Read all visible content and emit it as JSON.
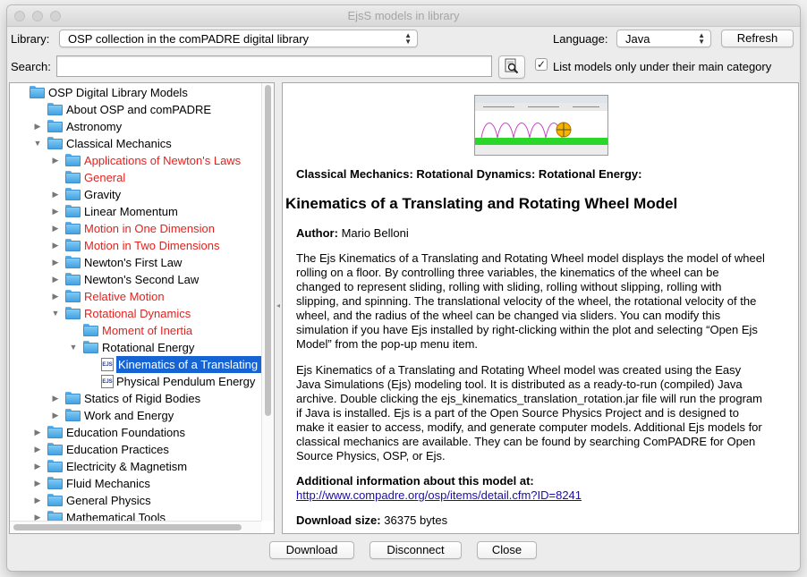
{
  "window": {
    "title": "EjsS models in library"
  },
  "toolbar": {
    "library_label": "Library:",
    "library_value": "OSP collection in the comPADRE digital library",
    "language_label": "Language:",
    "language_value": "Java",
    "refresh_label": "Refresh",
    "search_label": "Search:",
    "search_value": "",
    "checkbox_checked": true,
    "checkbox_label": "List models only under their main category"
  },
  "tree": {
    "items": [
      {
        "label": "OSP Digital Library Models",
        "level": 0,
        "expander": "none",
        "icon": "folder",
        "color": "normal"
      },
      {
        "label": "About OSP and comPADRE",
        "level": 1,
        "expander": "none",
        "icon": "folder",
        "color": "normal"
      },
      {
        "label": "Astronomy",
        "level": 1,
        "expander": "collapsed",
        "icon": "folder",
        "color": "normal"
      },
      {
        "label": "Classical Mechanics",
        "level": 1,
        "expander": "expanded",
        "icon": "folder",
        "color": "normal"
      },
      {
        "label": "Applications of Newton's Laws",
        "level": 2,
        "expander": "collapsed",
        "icon": "folder",
        "color": "red"
      },
      {
        "label": "General",
        "level": 2,
        "expander": "none",
        "icon": "folder",
        "color": "red"
      },
      {
        "label": "Gravity",
        "level": 2,
        "expander": "collapsed",
        "icon": "folder",
        "color": "normal"
      },
      {
        "label": "Linear Momentum",
        "level": 2,
        "expander": "collapsed",
        "icon": "folder",
        "color": "normal"
      },
      {
        "label": "Motion in One Dimension",
        "level": 2,
        "expander": "collapsed",
        "icon": "folder",
        "color": "red"
      },
      {
        "label": "Motion in Two Dimensions",
        "level": 2,
        "expander": "collapsed",
        "icon": "folder",
        "color": "red"
      },
      {
        "label": "Newton's First Law",
        "level": 2,
        "expander": "collapsed",
        "icon": "folder",
        "color": "normal"
      },
      {
        "label": "Newton's Second Law",
        "level": 2,
        "expander": "collapsed",
        "icon": "folder",
        "color": "normal"
      },
      {
        "label": "Relative Motion",
        "level": 2,
        "expander": "collapsed",
        "icon": "folder",
        "color": "red"
      },
      {
        "label": "Rotational Dynamics",
        "level": 2,
        "expander": "expanded",
        "icon": "folder",
        "color": "red"
      },
      {
        "label": "Moment of Inertia",
        "level": 3,
        "expander": "none",
        "icon": "folder",
        "color": "red"
      },
      {
        "label": "Rotational Energy",
        "level": 3,
        "expander": "expanded",
        "icon": "folder",
        "color": "normal"
      },
      {
        "label": "Kinematics of a Translating and",
        "level": 4,
        "expander": "none",
        "icon": "ejs-doc",
        "color": "selected"
      },
      {
        "label": "Physical Pendulum Energy",
        "level": 4,
        "expander": "none",
        "icon": "ejs-doc",
        "color": "normal"
      },
      {
        "label": "Statics of Rigid Bodies",
        "level": 2,
        "expander": "collapsed",
        "icon": "folder",
        "color": "normal"
      },
      {
        "label": "Work and Energy",
        "level": 2,
        "expander": "collapsed",
        "icon": "folder",
        "color": "normal"
      },
      {
        "label": "Education Foundations",
        "level": 1,
        "expander": "collapsed",
        "icon": "folder",
        "color": "normal"
      },
      {
        "label": "Education Practices",
        "level": 1,
        "expander": "collapsed",
        "icon": "folder",
        "color": "normal"
      },
      {
        "label": "Electricity & Magnetism",
        "level": 1,
        "expander": "collapsed",
        "icon": "folder",
        "color": "normal"
      },
      {
        "label": "Fluid Mechanics",
        "level": 1,
        "expander": "collapsed",
        "icon": "folder",
        "color": "normal"
      },
      {
        "label": "General Physics",
        "level": 1,
        "expander": "collapsed",
        "icon": "folder",
        "color": "normal"
      },
      {
        "label": "Mathematical Tools",
        "level": 1,
        "expander": "collapsed",
        "icon": "folder",
        "color": "normal"
      }
    ]
  },
  "detail": {
    "category": "Classical Mechanics: Rotational Dynamics: Rotational Energy:",
    "title": "Kinematics of a Translating and Rotating Wheel Model",
    "author_label": "Author:",
    "author_value": "Mario Belloni",
    "paragraph1": "The Ejs Kinematics of a Translating and Rotating Wheel model displays the model of wheel rolling on a floor. By controlling three variables, the kinematics of the wheel can be changed to represent sliding, rolling with sliding, rolling without slipping, rolling with slipping, and spinning. The translational velocity of the wheel, the rotational velocity of the wheel, and the radius of the wheel can be changed via sliders. You can modify this simulation if you have Ejs installed by right-clicking within the plot and selecting “Open Ejs Model” from the pop-up menu item.",
    "paragraph2": "Ejs Kinematics of a Translating and Rotating Wheel model was created using the Easy Java Simulations (Ejs) modeling tool. It is distributed as a ready-to-run (compiled) Java archive. Double clicking the ejs_kinematics_translation_rotation.jar file will run the program if Java is installed. Ejs is a part of the Open Source Physics Project and is designed to make it easier to access, modify, and generate computer models. Additional Ejs models for classical mechanics are available. They can be found by searching ComPADRE for Open Source Physics, OSP, or Ejs.",
    "additional_label": "Additional information about this model at:",
    "additional_link": "http://www.compadre.org/osp/items/detail.cfm?ID=8241",
    "download_size_label": "Download size:",
    "download_size_value": "36375 bytes"
  },
  "buttons": {
    "download": "Download",
    "disconnect": "Disconnect",
    "close": "Close"
  },
  "colors": {
    "selection": "#1664d3",
    "highlight_red": "#e8201c",
    "link": "#1a0dab"
  }
}
